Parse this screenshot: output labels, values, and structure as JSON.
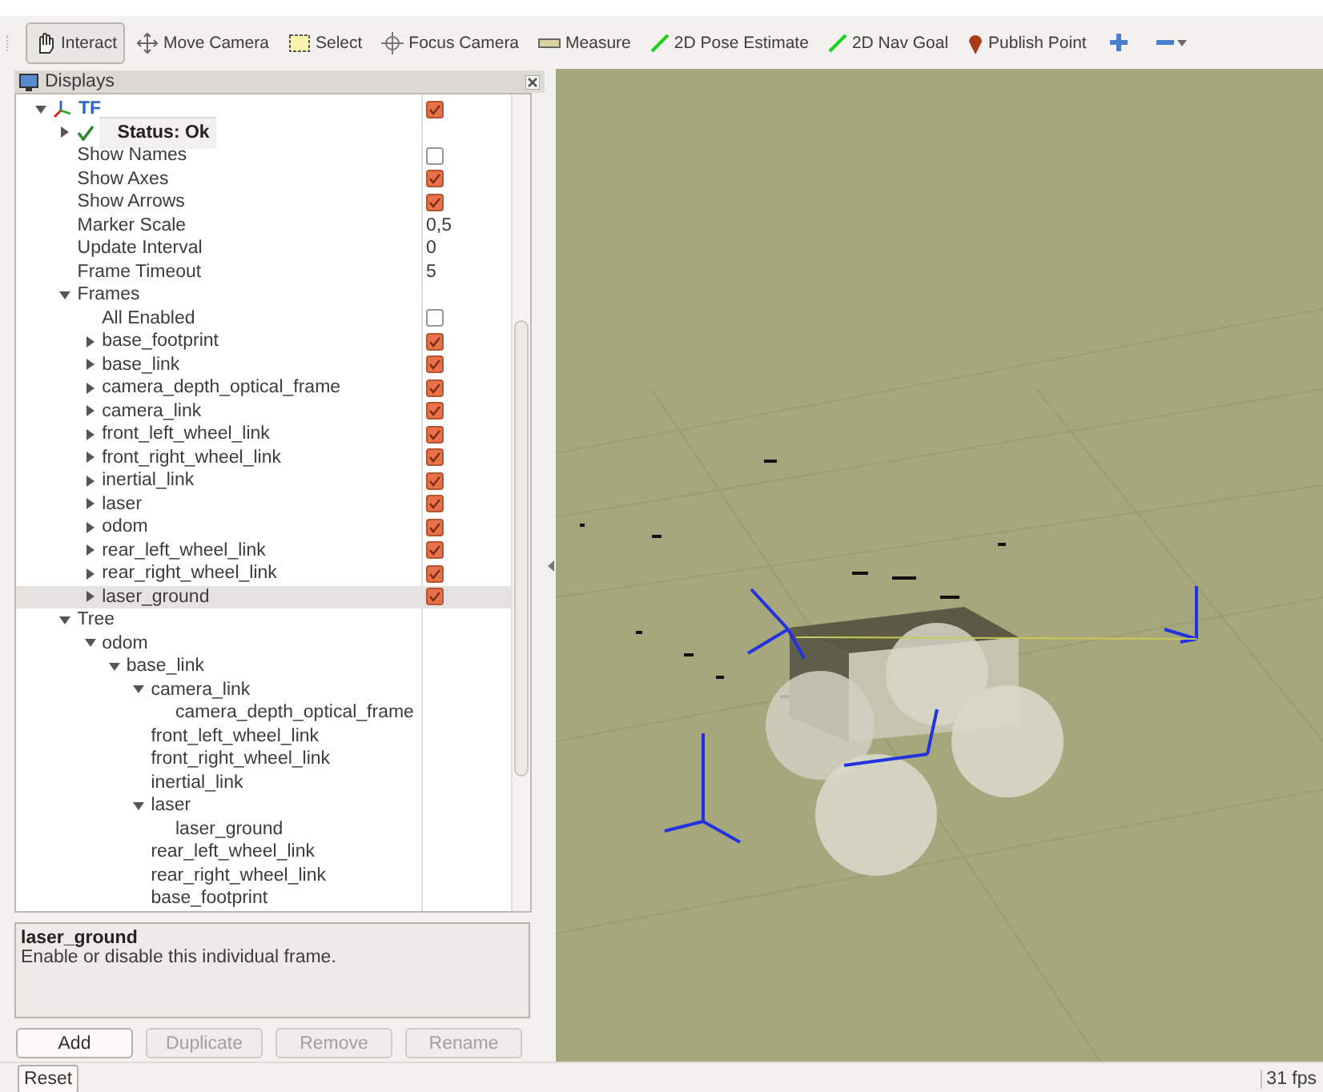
{
  "toolbar": {
    "tools": [
      {
        "label": "Interact",
        "kind": "interact",
        "selected": true
      },
      {
        "label": "Move Camera",
        "kind": "move",
        "selected": false
      },
      {
        "label": "Select",
        "kind": "select",
        "selected": false
      },
      {
        "label": "Focus Camera",
        "kind": "focus",
        "selected": false
      },
      {
        "label": "Measure",
        "kind": "measure",
        "selected": false
      },
      {
        "label": "2D Pose Estimate",
        "kind": "pose",
        "selected": false
      },
      {
        "label": "2D Nav Goal",
        "kind": "nav",
        "selected": false
      },
      {
        "label": "Publish Point",
        "kind": "point",
        "selected": false
      }
    ]
  },
  "displays": {
    "title": "Displays",
    "tree": [
      {
        "label": "TF",
        "kind": "display",
        "expanded": true,
        "checked": true,
        "children": [
          {
            "label": "Status: Ok",
            "kind": "status",
            "expanded": false
          },
          {
            "label": "Show Names",
            "checked": false
          },
          {
            "label": "Show Axes",
            "checked": true
          },
          {
            "label": "Show Arrows",
            "checked": true
          },
          {
            "label": "Marker Scale",
            "value": "0,5"
          },
          {
            "label": "Update Interval",
            "value": "0"
          },
          {
            "label": "Frame Timeout",
            "value": "5"
          },
          {
            "label": "Frames",
            "expanded": true,
            "children": [
              {
                "label": "All Enabled",
                "checked": false
              },
              {
                "label": "base_footprint",
                "expanded": false,
                "checked": true,
                "selected": false
              },
              {
                "label": "base_link",
                "expanded": false,
                "checked": true,
                "selected": false
              },
              {
                "label": "camera_depth_optical_frame",
                "expanded": false,
                "checked": true,
                "selected": false
              },
              {
                "label": "camera_link",
                "expanded": false,
                "checked": true,
                "selected": false
              },
              {
                "label": "front_left_wheel_link",
                "expanded": false,
                "checked": true,
                "selected": false
              },
              {
                "label": "front_right_wheel_link",
                "expanded": false,
                "checked": true,
                "selected": false
              },
              {
                "label": "inertial_link",
                "expanded": false,
                "checked": true,
                "selected": false
              },
              {
                "label": "laser",
                "expanded": false,
                "checked": true,
                "selected": false
              },
              {
                "label": "odom",
                "expanded": false,
                "checked": true,
                "selected": false
              },
              {
                "label": "rear_left_wheel_link",
                "expanded": false,
                "checked": true,
                "selected": false
              },
              {
                "label": "rear_right_wheel_link",
                "expanded": false,
                "checked": true,
                "selected": false
              },
              {
                "label": "laser_ground",
                "expanded": false,
                "checked": true,
                "selected": true
              }
            ]
          },
          {
            "label": "Tree",
            "expanded": true,
            "children": [
              {
                "label": "odom",
                "expanded": true,
                "children": [
                  {
                    "label": "base_link",
                    "expanded": true,
                    "children": [
                      {
                        "label": "camera_link",
                        "expanded": true,
                        "children": [
                          {
                            "label": "camera_depth_optical_frame"
                          }
                        ]
                      },
                      {
                        "label": "front_left_wheel_link"
                      },
                      {
                        "label": "front_right_wheel_link"
                      },
                      {
                        "label": "inertial_link"
                      },
                      {
                        "label": "laser",
                        "expanded": true,
                        "children": [
                          {
                            "label": "laser_ground"
                          }
                        ]
                      },
                      {
                        "label": "rear_left_wheel_link"
                      },
                      {
                        "label": "rear_right_wheel_link"
                      },
                      {
                        "label": "base_footprint"
                      }
                    ]
                  }
                ]
              }
            ]
          }
        ]
      }
    ],
    "description": {
      "title": "laser_ground",
      "text": "Enable or disable this individual frame."
    },
    "buttons": [
      {
        "label": "Add",
        "disabled": false
      },
      {
        "label": "Duplicate",
        "disabled": true
      },
      {
        "label": "Remove",
        "disabled": true
      },
      {
        "label": "Rename",
        "disabled": true
      }
    ]
  },
  "status_bar": {
    "reset": "Reset",
    "fps": "31 fps"
  }
}
